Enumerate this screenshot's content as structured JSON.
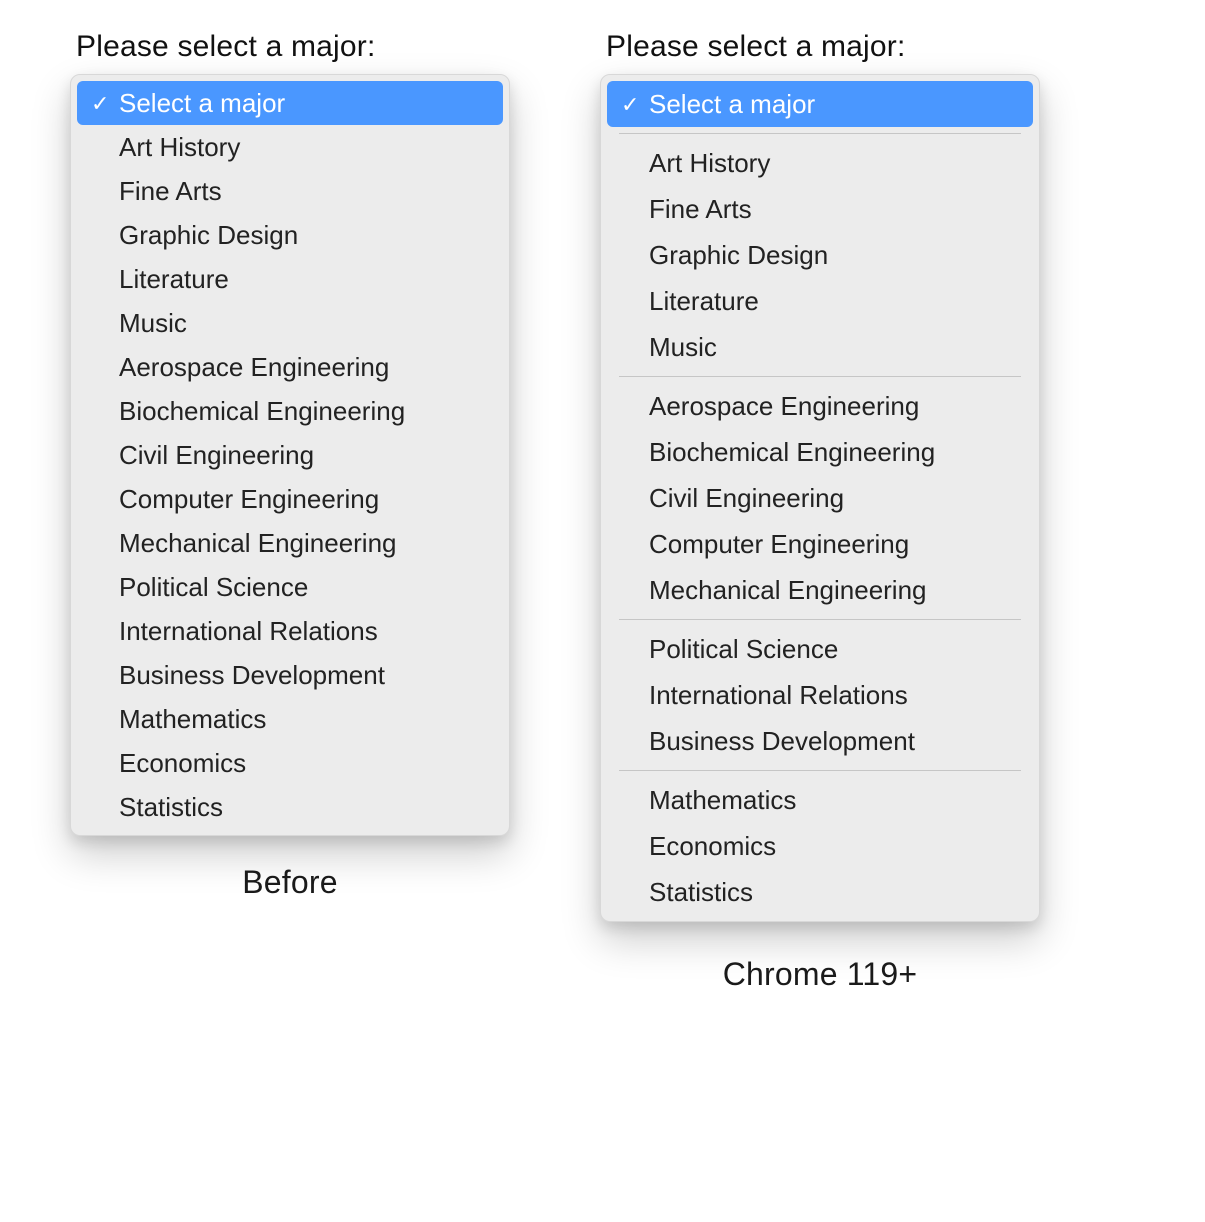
{
  "prompt": "Please select a major:",
  "placeholder": "Select a major",
  "captions": {
    "before": "Before",
    "after": "Chrome 119+"
  },
  "flat_items": [
    "Art History",
    "Fine Arts",
    "Graphic Design",
    "Literature",
    "Music",
    "Aerospace Engineering",
    "Biochemical Engineering",
    "Civil Engineering",
    "Computer Engineering",
    "Mechanical Engineering",
    "Political Science",
    "International Relations",
    "Business Development",
    "Mathematics",
    "Economics",
    "Statistics"
  ],
  "groups": [
    {
      "items": [
        "Art History",
        "Fine Arts",
        "Graphic Design",
        "Literature",
        "Music"
      ]
    },
    {
      "items": [
        "Aerospace Engineering",
        "Biochemical Engineering",
        "Civil Engineering",
        "Computer Engineering",
        "Mechanical Engineering"
      ]
    },
    {
      "items": [
        "Political Science",
        "International Relations",
        "Business Development"
      ]
    },
    {
      "items": [
        "Mathematics",
        "Economics",
        "Statistics"
      ]
    }
  ]
}
